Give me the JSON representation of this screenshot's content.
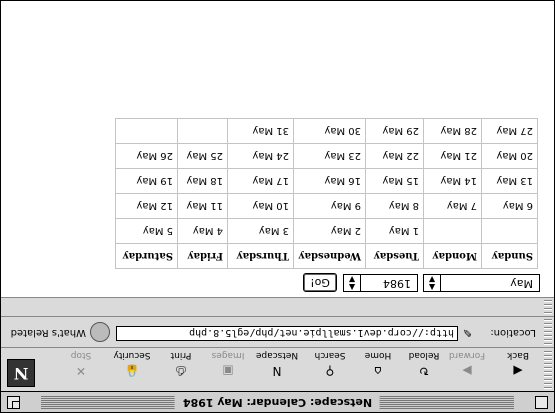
{
  "window": {
    "title": "Netscape: Calendar: May 1984"
  },
  "toolbar": {
    "buttons": [
      {
        "label": "Back",
        "icon": "back-arrow-icon",
        "enabled": true
      },
      {
        "label": "Forward",
        "icon": "forward-arrow-icon",
        "enabled": false
      },
      {
        "label": "Reload",
        "icon": "reload-icon",
        "enabled": true
      },
      {
        "label": "Home",
        "icon": "home-icon",
        "enabled": true
      },
      {
        "label": "Search",
        "icon": "search-icon",
        "enabled": true
      },
      {
        "label": "Netscape",
        "icon": "netscape-icon",
        "enabled": true
      },
      {
        "label": "Images",
        "icon": "images-icon",
        "enabled": false
      },
      {
        "label": "Print",
        "icon": "print-icon",
        "enabled": true
      },
      {
        "label": "Security",
        "icon": "security-icon",
        "enabled": true
      },
      {
        "label": "Stop",
        "icon": "stop-icon",
        "enabled": false
      }
    ],
    "logo": "N"
  },
  "location": {
    "label": "Location:",
    "url": "http://corp.dev1.smallpie.net/php/egl5.8.php",
    "related_label": "What's Related"
  },
  "form": {
    "month": "May",
    "year": "1984",
    "go_label": "Go!"
  },
  "calendar": {
    "headers": [
      "Sunday",
      "Monday",
      "Tuesday",
      "Wednesday",
      "Thursday",
      "Friday",
      "Saturday"
    ],
    "weeks": [
      [
        "",
        "",
        "1 May",
        "2 May",
        "3 May",
        "4 May",
        "5 May"
      ],
      [
        "6 May",
        "7 May",
        "8 May",
        "9 May",
        "10 May",
        "11 May",
        "12 May"
      ],
      [
        "13 May",
        "14 May",
        "15 May",
        "16 May",
        "17 May",
        "18 May",
        "19 May"
      ],
      [
        "20 May",
        "21 May",
        "22 May",
        "23 May",
        "24 May",
        "25 May",
        "26 May"
      ],
      [
        "27 May",
        "28 May",
        "29 May",
        "30 May",
        "31 May",
        "",
        ""
      ]
    ]
  }
}
